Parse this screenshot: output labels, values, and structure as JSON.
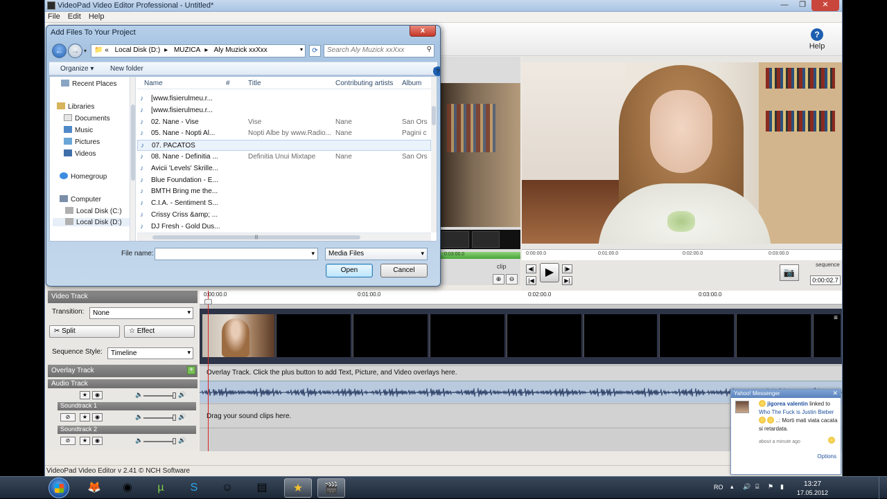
{
  "app": {
    "title": "VideoPad Video Editor Professional - Untitled*",
    "menu": [
      "File",
      "Edit",
      "Help"
    ],
    "help_label": "Help",
    "status": "VideoPad Video Editor v 2.41 © NCH Software"
  },
  "clip_bin": {
    "clip_label": "clip",
    "strip_time": "0:03:00.0"
  },
  "sequence": {
    "ruler": [
      "0:00:00.0",
      "0:01:00.0",
      "0:02:00.0",
      "0:03:00.0"
    ],
    "label": "sequence",
    "time": "0:00:02.7"
  },
  "timeline": {
    "video_track_label": "Video Track",
    "transition_label": "Transition:",
    "transition_value": "None",
    "split_label": "Split",
    "effect_label": "Effect",
    "sequence_style_label": "Sequence Style:",
    "sequence_style_value": "Timeline",
    "overlay_track_label": "Overlay Track",
    "audio_track_label": "Audio Track",
    "soundtrack1_label": "Soundtrack 1",
    "soundtrack2_label": "Soundtrack 2",
    "ruler": [
      "0:00:00.0",
      "0:01:00.0",
      "0:02:00.0",
      "0:03:00.0"
    ],
    "overlay_hint": "Overlay Track. Click the plus button to add Text, Picture, and Video overlays here.",
    "sound_hint": "Drag your sound clips here."
  },
  "dialog": {
    "title": "Add Files To Your Project",
    "close_label": "x",
    "address": [
      "Local Disk (D:)",
      "MUZICA",
      "Aly Muzick xxXxx"
    ],
    "search_placeholder": "Search Aly Muzick xxXxx",
    "organize_label": "Organize ▾",
    "new_folder_label": "New folder",
    "tree": [
      {
        "label": "Recent Places"
      },
      {
        "label": "Libraries"
      },
      {
        "label": "Documents"
      },
      {
        "label": "Music"
      },
      {
        "label": "Pictures"
      },
      {
        "label": "Videos"
      },
      {
        "label": "Homegroup"
      },
      {
        "label": "Computer"
      },
      {
        "label": "Local Disk (C:)"
      },
      {
        "label": "Local Disk (D:)"
      }
    ],
    "columns": [
      "Name",
      "#",
      "Title",
      "Contributing artists",
      "Album"
    ],
    "files": [
      {
        "name": "[www.fisierulmeu.r...",
        "num": "",
        "title": "",
        "artist": "",
        "album": ""
      },
      {
        "name": "[www.fisierulmeu.r...",
        "num": "",
        "title": "",
        "artist": "",
        "album": ""
      },
      {
        "name": "02. Nane - Vise",
        "num": "",
        "title": "Vise",
        "artist": "Nane",
        "album": "San Ors"
      },
      {
        "name": "05. Nane - Nopti Al...",
        "num": "",
        "title": "Nopti Albe by www.Radio...",
        "artist": "Nane",
        "album": "Pagini c"
      },
      {
        "name": "07. PACATOS",
        "num": "",
        "title": "",
        "artist": "",
        "album": ""
      },
      {
        "name": "08. Nane - Definitia ...",
        "num": "",
        "title": "Definitia Unui Mixtape",
        "artist": "Nane",
        "album": "San Ors"
      },
      {
        "name": "Avicii 'Levels' Skrille...",
        "num": "",
        "title": "",
        "artist": "",
        "album": ""
      },
      {
        "name": "Blue Foundation - E...",
        "num": "",
        "title": "",
        "artist": "",
        "album": ""
      },
      {
        "name": "BMTH Bring me the...",
        "num": "",
        "title": "",
        "artist": "",
        "album": ""
      },
      {
        "name": "C.I.A. - Sentiment S...",
        "num": "",
        "title": "",
        "artist": "",
        "album": ""
      },
      {
        "name": "Crissy Criss &amp; ...",
        "num": "",
        "title": "",
        "artist": "",
        "album": ""
      },
      {
        "name": "DJ Fresh - Gold Dus...",
        "num": "",
        "title": "",
        "artist": "",
        "album": ""
      }
    ],
    "selected_index": 4,
    "file_name_label": "File name:",
    "file_name_value": "",
    "file_type_value": "Media Files",
    "open_label": "Open",
    "cancel_label": "Cancel"
  },
  "messenger": {
    "header": "Yahoo! Messenger",
    "sender": "jigorea valentin",
    "linked_text": " linked to",
    "link_text": "Who The Fuck is Justin Bieber",
    "message": "..: Morti mati viata cacata si retardata.",
    "time": "about a minute ago",
    "options": "Options"
  },
  "taskbar": {
    "lang": "RO",
    "time": "13:27",
    "date": "17.05.2012"
  },
  "colors": {
    "accent": "#1d5fb0",
    "playhead": "#d22222",
    "audio_lane": "#b9c9de"
  }
}
